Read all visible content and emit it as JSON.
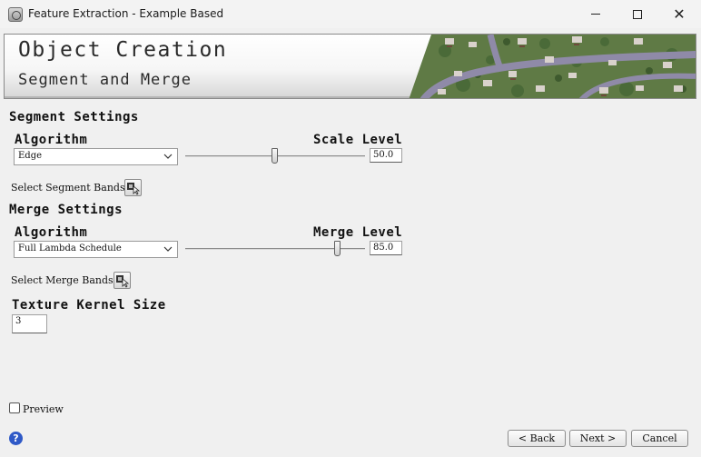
{
  "window": {
    "title": "Feature Extraction - Example Based",
    "minimize_icon": "minimize-icon",
    "maximize_icon": "maximize-icon",
    "close_glyph": "✕"
  },
  "banner": {
    "title": "Object Creation",
    "subtitle": "Segment and Merge"
  },
  "segment": {
    "heading": "Segment Settings",
    "algorithm_label": "Algorithm",
    "algorithm_value": "Edge",
    "level_label": "Scale Level",
    "level_value": "50.0",
    "level_fraction": 0.5,
    "bands_label": "Select Segment Bands"
  },
  "merge": {
    "heading": "Merge Settings",
    "algorithm_label": "Algorithm",
    "algorithm_value": "Full Lambda Schedule",
    "level_label": "Merge Level",
    "level_value": "85.0",
    "level_fraction": 0.85,
    "bands_label": "Select Merge Bands"
  },
  "texture": {
    "label": "Texture Kernel Size",
    "value": "3"
  },
  "preview": {
    "label": "Preview",
    "checked": false
  },
  "buttons": {
    "help": "?",
    "back": "< Back",
    "next": "Next >",
    "cancel": "Cancel"
  },
  "colors": {
    "accent": "#2f59c7"
  }
}
